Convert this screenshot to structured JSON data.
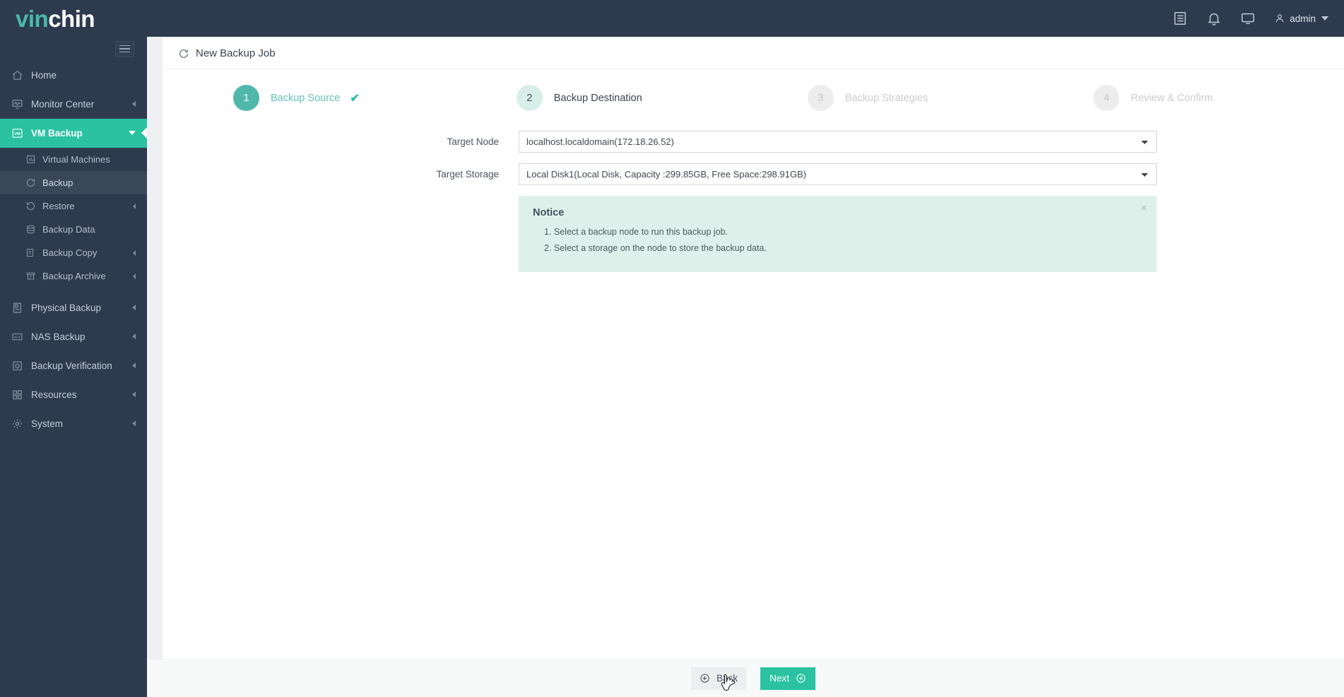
{
  "brand": {
    "part1": "vin",
    "part2": "chin"
  },
  "topbar": {
    "icons": [
      {
        "name": "logs-icon",
        "glyph": "list"
      },
      {
        "name": "notification-bell-icon",
        "glyph": "bell"
      },
      {
        "name": "console-monitor-icon",
        "glyph": "monitor"
      }
    ],
    "user": "admin"
  },
  "sidebar": {
    "items": [
      {
        "label": "Home",
        "icon": "home-icon",
        "expandable": false,
        "active": false
      },
      {
        "label": "Monitor Center",
        "icon": "monitor-center-icon",
        "expandable": true,
        "active": false
      },
      {
        "label": "VM Backup",
        "icon": "vm-backup-icon",
        "expandable": true,
        "active": true
      }
    ],
    "subitems": [
      {
        "label": "Virtual Machines",
        "icon": "virtual-machines-icon",
        "expandable": false,
        "selected": false
      },
      {
        "label": "Backup",
        "icon": "backup-icon",
        "expandable": false,
        "selected": true
      },
      {
        "label": "Restore",
        "icon": "restore-icon",
        "expandable": true,
        "selected": false
      },
      {
        "label": "Backup Data",
        "icon": "backup-data-icon",
        "expandable": false,
        "selected": false
      },
      {
        "label": "Backup Copy",
        "icon": "backup-copy-icon",
        "expandable": true,
        "selected": false
      },
      {
        "label": "Backup Archive",
        "icon": "backup-archive-icon",
        "expandable": true,
        "selected": false
      }
    ],
    "items_bottom": [
      {
        "label": "Physical Backup",
        "icon": "physical-backup-icon",
        "expandable": true
      },
      {
        "label": "NAS Backup",
        "icon": "nas-backup-icon",
        "expandable": true
      },
      {
        "label": "Backup Verification",
        "icon": "backup-verification-icon",
        "expandable": true
      },
      {
        "label": "Resources",
        "icon": "resources-icon",
        "expandable": true
      },
      {
        "label": "System",
        "icon": "system-gear-icon",
        "expandable": true
      }
    ]
  },
  "page": {
    "title": "New Backup Job",
    "title_icon": "refresh-circle-icon"
  },
  "steps": [
    {
      "num": "1",
      "label": "Backup Source",
      "state": "done",
      "check": "✔"
    },
    {
      "num": "2",
      "label": "Backup Destination",
      "state": "current",
      "check": ""
    },
    {
      "num": "3",
      "label": "Backup Strategies",
      "state": "todo",
      "check": ""
    },
    {
      "num": "4",
      "label": "Review & Confirm",
      "state": "todo",
      "check": ""
    }
  ],
  "form": {
    "target_node": {
      "label": "Target Node",
      "value": "localhost.localdomain(172.18.26.52)"
    },
    "target_storage": {
      "label": "Target Storage",
      "value": "Local Disk1(Local Disk, Capacity :299.85GB, Free Space:298.91GB)"
    }
  },
  "notice": {
    "title": "Notice",
    "close": "×",
    "lines": [
      "1. Select a backup node to run this backup job.",
      "2. Select a storage on the node to store the backup data."
    ]
  },
  "footer": {
    "back_label": "Back",
    "next_label": "Next"
  },
  "colors": {
    "accent_teal": "#2ac2a1",
    "sidebar_dark": "#2e3b4e",
    "step_done": "#4fb8ab",
    "notice_bg": "#ddf1ea"
  }
}
